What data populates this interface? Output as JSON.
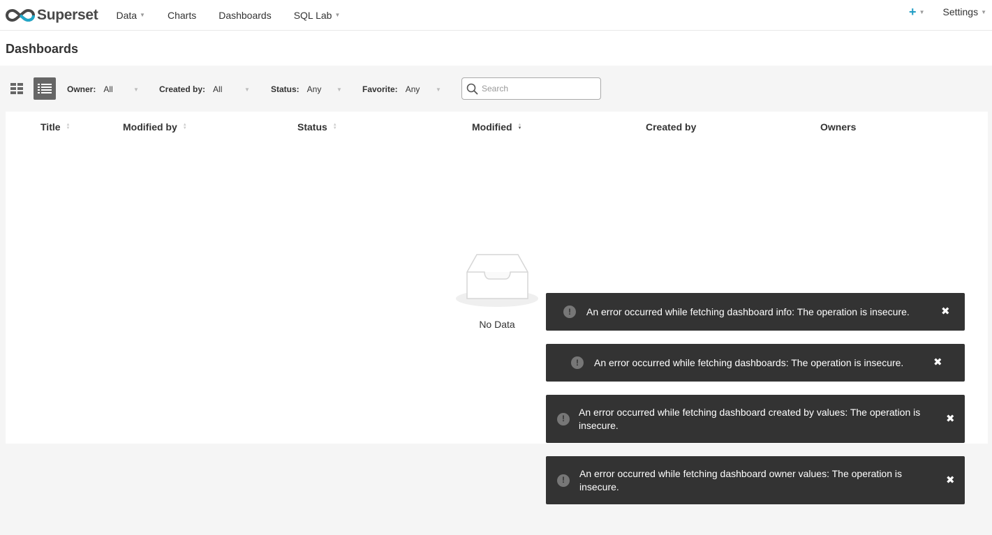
{
  "navbar": {
    "brand": "Superset",
    "menu": [
      {
        "label": "Data",
        "has_caret": true
      },
      {
        "label": "Charts",
        "has_caret": false
      },
      {
        "label": "Dashboards",
        "has_caret": false
      },
      {
        "label": "SQL Lab",
        "has_caret": true
      }
    ],
    "plus_icon": "plus-icon",
    "settings_label": "Settings",
    "accent_color": "#1f9cc4"
  },
  "page": {
    "title": "Dashboards"
  },
  "filters": {
    "owner": {
      "label": "Owner:",
      "value": "All"
    },
    "created_by": {
      "label": "Created by:",
      "value": "All"
    },
    "status": {
      "label": "Status:",
      "value": "Any"
    },
    "favorite": {
      "label": "Favorite:",
      "value": "Any"
    },
    "search_placeholder": "Search"
  },
  "table": {
    "columns": [
      {
        "label": "Title",
        "sortable": true
      },
      {
        "label": "Modified by",
        "sortable": true
      },
      {
        "label": "Status",
        "sortable": true
      },
      {
        "label": "Modified",
        "sortable": true,
        "sorted": "desc"
      },
      {
        "label": "Created by",
        "sortable": false
      },
      {
        "label": "Owners",
        "sortable": false
      }
    ],
    "empty_text": "No Data"
  },
  "toasts": [
    {
      "message": "An error occurred while fetching dashboard info: The operation is insecure."
    },
    {
      "message": "An error occurred while fetching dashboards: The operation is insecure."
    },
    {
      "message": "An error occurred while fetching dashboard created by values: The operation is insecure."
    },
    {
      "message": "An error occurred while fetching dashboard owner values: The operation is insecure."
    }
  ],
  "toast_style": {
    "background": "#333333",
    "icon": "exclamation-icon",
    "close_icon": "close-icon"
  }
}
